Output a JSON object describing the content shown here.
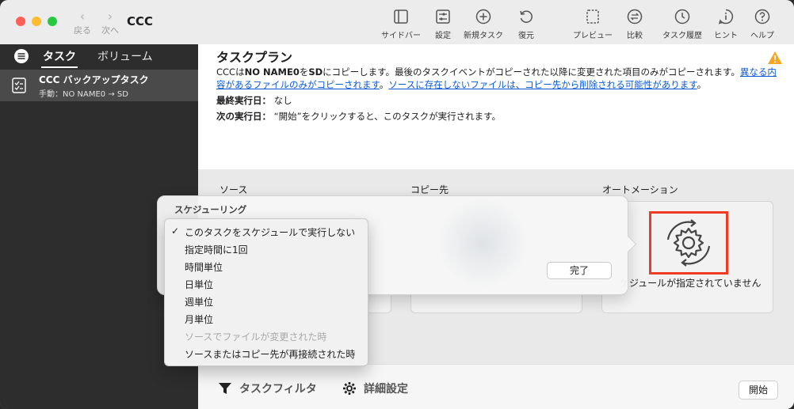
{
  "window": {
    "title": "CCC"
  },
  "nav": {
    "back_label": "戻る",
    "forward_label": "次へ"
  },
  "toolbar": {
    "sidebar": "サイドバー",
    "settings": "設定",
    "new_task": "新規タスク",
    "restore": "復元",
    "preview": "プレビュー",
    "compare": "比較",
    "task_history": "タスク履歴",
    "hint": "ヒント",
    "help": "ヘルプ"
  },
  "sidebar": {
    "tabs": [
      {
        "label": "タスク",
        "active": true
      },
      {
        "label": "ボリューム",
        "active": false
      }
    ],
    "items": [
      {
        "name": "CCC バックアップタスク",
        "subtitle": "手動：NO NAME0 → SD"
      }
    ]
  },
  "plan": {
    "title": "タスクプラン",
    "desc_prefix": "CCCは",
    "desc_source": "NO NAME0",
    "desc_mid": "を",
    "desc_dest": "SD",
    "desc_text": "にコピーします。最後のタスクイベントがコピーされた以降に変更された項目のみがコピーされます。",
    "desc_link1": "異なる内容があるファイルのみがコピーされます",
    "desc_sep": "。",
    "desc_link2": "ソースに存在しないファイルは、コピー先から削除される可能性があります",
    "desc_end": "。",
    "last_run_label": "最終実行日：",
    "last_run_value": "なし",
    "next_run_label": "次の実行日：",
    "next_run_value": "“開始”をクリックすると、このタスクが実行されます。"
  },
  "columns": {
    "source": "ソース",
    "destination": "コピー先",
    "automation": "オートメーション"
  },
  "automation": {
    "note": "ケジュールが指定されていません"
  },
  "popover": {
    "title": "スケジューリング",
    "done_label": "完了"
  },
  "schedule_menu": {
    "items": [
      {
        "label": "このタスクをスケジュールで実行しない",
        "checked": true,
        "disabled": false
      },
      {
        "label": "指定時間に1回",
        "checked": false,
        "disabled": false
      },
      {
        "label": "時間単位",
        "checked": false,
        "disabled": false
      },
      {
        "label": "日単位",
        "checked": false,
        "disabled": false
      },
      {
        "label": "週単位",
        "checked": false,
        "disabled": false
      },
      {
        "label": "月単位",
        "checked": false,
        "disabled": false
      },
      {
        "label": "ソースでファイルが変更された時",
        "checked": false,
        "disabled": true
      },
      {
        "label": "ソースまたはコピー先が再接続された時",
        "checked": false,
        "disabled": false
      }
    ],
    "check_glyph": "✓"
  },
  "bottombar": {
    "task_filter": "タスクフィルタ",
    "advanced": "詳細設定",
    "start_label": "開始"
  },
  "colors": {
    "accent": "#2a6ee6",
    "highlight_box": "#f03a22",
    "link": "#0a5ad6",
    "warning": "#f5a623"
  }
}
